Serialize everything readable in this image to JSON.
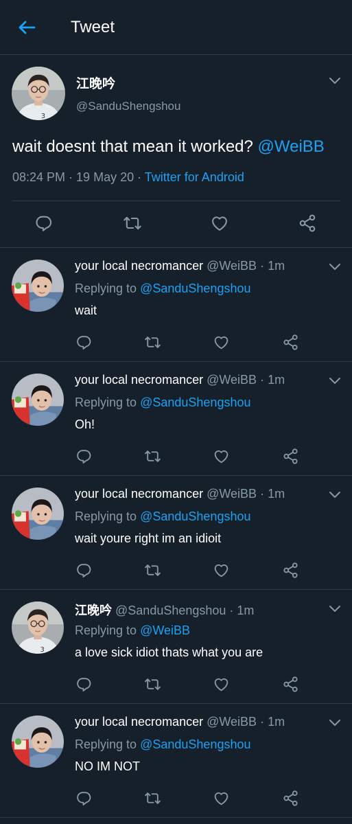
{
  "header": {
    "title": "Tweet",
    "back_icon": "arrow-left-icon"
  },
  "colors": {
    "background": "#15202b",
    "accent": "#1da1f2",
    "secondary_text": "#8899a6",
    "divider": "#2f3b47"
  },
  "main_tweet": {
    "name": "江晚吟",
    "handle": "@SanduShengshou",
    "text": "wait doesnt that mean it worked?",
    "mention": "@WeiBB",
    "time": "08:24 PM",
    "sep1": " · ",
    "date": "19 May 20",
    "sep2": " · ",
    "source": "Twitter for Android"
  },
  "replies": [
    {
      "name": "your local necromancer",
      "handle": "@WeiBB",
      "dot": " · ",
      "time": "1m",
      "replying_prefix": "Replying to",
      "replying_to": "@SanduShengshou",
      "text": "wait"
    },
    {
      "name": "your local necromancer",
      "handle": "@WeiBB",
      "dot": " · ",
      "time": "1m",
      "replying_prefix": "Replying to",
      "replying_to": "@SanduShengshou",
      "text": "Oh!"
    },
    {
      "name": "your local necromancer",
      "handle": "@WeiBB",
      "dot": " · ",
      "time": "1m",
      "replying_prefix": "Replying to",
      "replying_to": "@SanduShengshou",
      "text": "wait youre right im an idioit"
    },
    {
      "name": "江晚吟",
      "handle": "@SanduShengshou",
      "dot": " · ",
      "time": "1m",
      "replying_prefix": "Replying to",
      "replying_to": "@WeiBB",
      "text": "a love sick idiot thats what you are"
    },
    {
      "name": "your local necromancer",
      "handle": "@WeiBB",
      "dot": " · ",
      "time": "1m",
      "replying_prefix": "Replying to",
      "replying_to": "@SanduShengshou",
      "text": "NO IM NOT"
    }
  ]
}
